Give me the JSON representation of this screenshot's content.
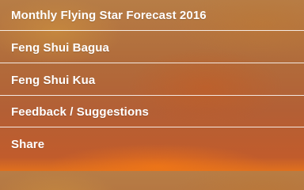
{
  "menu": {
    "items": [
      {
        "label": "Monthly Flying Star Forecast 2016"
      },
      {
        "label": "Feng Shui Bagua"
      },
      {
        "label": "Feng Shui Kua"
      },
      {
        "label": "Feedback / Suggestions"
      },
      {
        "label": "Share"
      }
    ]
  },
  "colors": {
    "text": "#ffffff",
    "divider": "#ffffff",
    "background_top": "#b77d46",
    "background_bottom": "#e0701e"
  }
}
